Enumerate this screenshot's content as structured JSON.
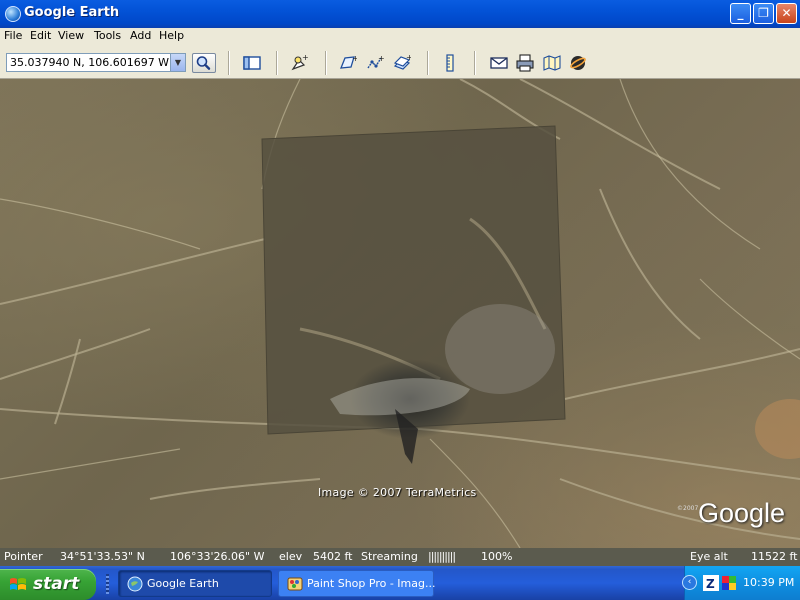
{
  "window": {
    "title": "Google Earth"
  },
  "menu": [
    "File",
    "Edit",
    "View",
    "Tools",
    "Add",
    "Help"
  ],
  "toolbar": {
    "search_value": "35.037940 N, 106.601697 W",
    "icons": [
      "sidebar-toggle-icon",
      "placemark-add-icon",
      "polygon-add-icon",
      "path-add-icon",
      "overlay-add-icon",
      "ruler-icon",
      "email-icon",
      "print-icon",
      "map-icon",
      "sky-icon"
    ]
  },
  "map": {
    "copyright": "Image © 2007 TerraMetrics",
    "logo": "Google",
    "logo_small": "©2007"
  },
  "status": {
    "pointer_label": "Pointer",
    "lat": "34°51'33.53\" N",
    "lon": "106°33'26.06\" W",
    "elev_label": "elev",
    "elev": "5402 ft",
    "streaming_label": "Streaming",
    "streaming_bars": "||||||||||",
    "streaming_pct": "100%",
    "eye_label": "Eye alt",
    "eye_alt": "11522 ft"
  },
  "taskbar": {
    "start": "start",
    "tasks": [
      {
        "label": "Google Earth"
      },
      {
        "label": "Paint Shop Pro - Imag..."
      }
    ],
    "clock": "10:39 PM"
  },
  "colors": {
    "xp_blue": "#0352d6",
    "start_green": "#37a335",
    "tray_blue": "#0f8fe0",
    "status_bg": "#5b5b4e"
  }
}
